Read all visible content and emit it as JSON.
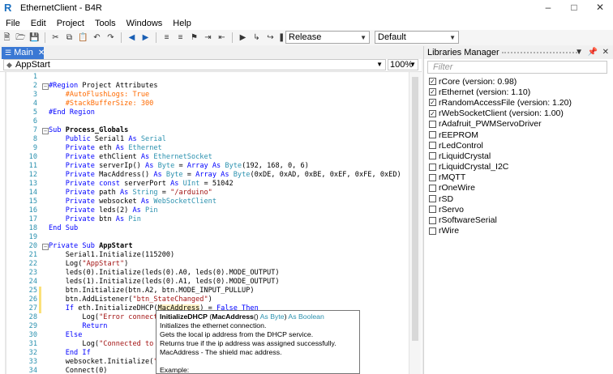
{
  "window": {
    "title": "EthernetClient - B4R"
  },
  "menu": [
    "File",
    "Edit",
    "Project",
    "Tools",
    "Windows",
    "Help"
  ],
  "toolbar": {
    "build_config": "Release",
    "target": "Default"
  },
  "tabs": [
    {
      "label": "Main"
    }
  ],
  "editor": {
    "sub_selector": "AppStart",
    "zoom": "100%",
    "lines": [
      {
        "n": "1",
        "html": ""
      },
      {
        "n": "2",
        "html": "<span class='kw'>#Region</span> Project Attributes"
      },
      {
        "n": "3",
        "html": "    <span class='dir'>#AutoFlushLogs: True</span>"
      },
      {
        "n": "4",
        "html": "    <span class='dir'>#StackBufferSize: 300</span>"
      },
      {
        "n": "5",
        "html": "<span class='kw'>#End Region</span>"
      },
      {
        "n": "6",
        "html": ""
      },
      {
        "n": "7",
        "html": "<span class='kw'>Sub</span> <span class='fn'>Process_Globals</span>"
      },
      {
        "n": "8",
        "html": "    <span class='kw'>Public</span> Serial1 <span class='kw'>As</span> <span class='ty'>Serial</span>"
      },
      {
        "n": "9",
        "html": "    <span class='kw'>Private</span> eth <span class='kw'>As</span> <span class='ty'>Ethernet</span>"
      },
      {
        "n": "10",
        "html": "    <span class='kw'>Private</span> ethClient <span class='kw'>As</span> <span class='ty'>EthernetSocket</span>"
      },
      {
        "n": "11",
        "html": "    <span class='kw'>Private</span> serverIp() <span class='kw'>As</span> <span class='ty'>Byte</span> = <span class='kw'>Array As</span> <span class='ty'>Byte</span>(192, 168, 0, 6)"
      },
      {
        "n": "12",
        "html": "    <span class='kw'>Private</span> MacAddress() <span class='kw'>As</span> <span class='ty'>Byte</span> = <span class='kw'>Array As</span> <span class='ty'>Byte</span>(0xDE, 0xAD, 0xBE, 0xEF, 0xFE, 0xED)"
      },
      {
        "n": "13",
        "html": "    <span class='kw'>Private const</span> serverPort <span class='kw'>As</span> <span class='ty'>UInt</span> = 51042"
      },
      {
        "n": "14",
        "html": "    <span class='kw'>Private</span> path <span class='kw'>As</span> <span class='ty'>String</span> = <span class='st'>\"/arduino\"</span>"
      },
      {
        "n": "15",
        "html": "    <span class='kw'>Private</span> websocket <span class='kw'>As</span> <span class='ty'>WebSocketClient</span>"
      },
      {
        "n": "16",
        "html": "    <span class='kw'>Private</span> leds(2) <span class='kw'>As</span> <span class='ty'>Pin</span>"
      },
      {
        "n": "17",
        "html": "    <span class='kw'>Private</span> btn <span class='kw'>As</span> <span class='ty'>Pin</span>"
      },
      {
        "n": "18",
        "html": "<span class='kw'>End Sub</span>"
      },
      {
        "n": "19",
        "html": ""
      },
      {
        "n": "20",
        "html": "<span class='kw'>Private Sub</span> <span class='fn'>AppStart</span>"
      },
      {
        "n": "21",
        "html": "    Serial1.Initialize(115200)"
      },
      {
        "n": "22",
        "html": "    Log(<span class='st'>\"AppStart\"</span>)"
      },
      {
        "n": "23",
        "html": "    leds(0).Initialize(leds(0).A0, leds(0).MODE_OUTPUT)"
      },
      {
        "n": "24",
        "html": "    leds(1).Initialize(leds(0).A1, leds(0).MODE_OUTPUT)"
      },
      {
        "n": "25",
        "html": "    btn.Initialize(btn.A2, btn.MODE_INPUT_PULLUP)"
      },
      {
        "n": "26",
        "html": "    btn.AddListener(<span class='st'>\"btn_StateChanged\"</span>)"
      },
      {
        "n": "27",
        "html": "    <span class='kw'>If</span> eth.InitializeDHCP(<span class='hl'>MacAddress</span>) = <span class='kw'>False Then</span>"
      },
      {
        "n": "28",
        "html": "        Log(<span class='st'>\"Error connecti</span>"
      },
      {
        "n": "29",
        "html": "        <span class='kw'>Return</span>"
      },
      {
        "n": "30",
        "html": "    <span class='kw'>Else</span>"
      },
      {
        "n": "31",
        "html": "        Log(<span class='st'>\"Connected to n</span>"
      },
      {
        "n": "32",
        "html": "    <span class='kw'>End If</span>"
      },
      {
        "n": "33",
        "html": "    websocket.Initialize(<span class='st'>\"w</span>"
      },
      {
        "n": "34",
        "html": "    Connect(0)"
      }
    ]
  },
  "tooltip": {
    "lines": [
      "InitializeDHCP (MacAddress() As Byte) As Boolean",
      "Initializes the ethernet connection.",
      "Gets the local ip address from the DHCP service.",
      "Returns true if the ip address was assigned successfully.",
      "MacAddress - The shield mac address.",
      "",
      "Example:"
    ]
  },
  "libraries_panel": {
    "title": "Libraries Manager",
    "filter_placeholder": "Filter",
    "items": [
      {
        "label": "rCore (version: 0.98)",
        "checked": true
      },
      {
        "label": "rEthernet (version: 1.10)",
        "checked": true
      },
      {
        "label": "rRandomAccessFile (version: 1.20)",
        "checked": true
      },
      {
        "label": "rWebSocketClient (version: 1.00)",
        "checked": true
      },
      {
        "label": "rAdafruit_PWMServoDriver",
        "checked": false
      },
      {
        "label": "rEEPROM",
        "checked": false
      },
      {
        "label": "rLedControl",
        "checked": false
      },
      {
        "label": "rLiquidCrystal",
        "checked": false
      },
      {
        "label": "rLiquidCrystal_I2C",
        "checked": false
      },
      {
        "label": "rMQTT",
        "checked": false
      },
      {
        "label": "rOneWire",
        "checked": false
      },
      {
        "label": "rSD",
        "checked": false
      },
      {
        "label": "rServo",
        "checked": false
      },
      {
        "label": "rSoftwareSerial",
        "checked": false
      },
      {
        "label": "rWire",
        "checked": false
      }
    ]
  }
}
